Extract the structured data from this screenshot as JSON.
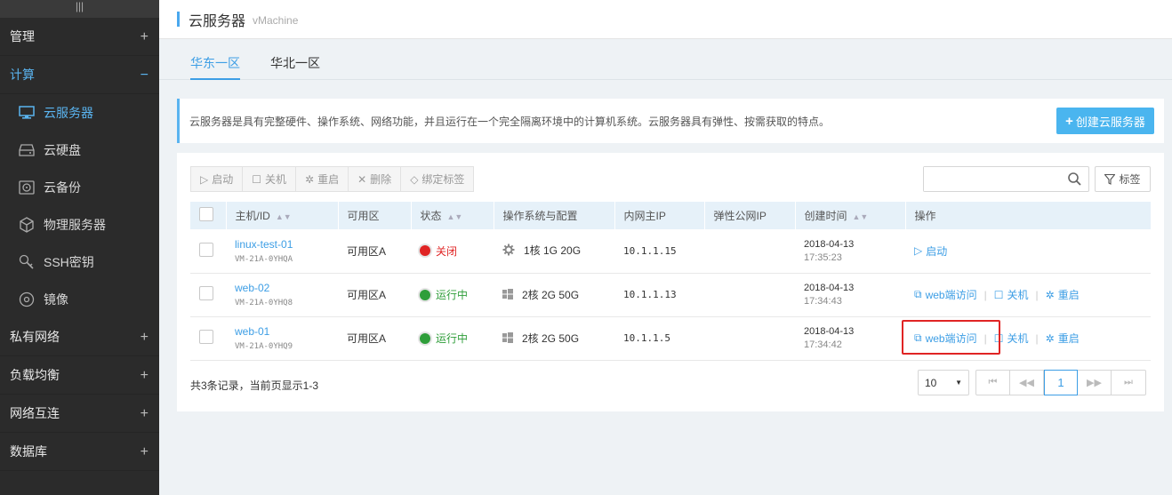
{
  "sidebar": {
    "groups": [
      {
        "label": "管理",
        "sign": "+"
      },
      {
        "label": "计算",
        "sign": "−"
      },
      {
        "label": "私有网络",
        "sign": "+"
      },
      {
        "label": "负载均衡",
        "sign": "+"
      },
      {
        "label": "网络互连",
        "sign": "+"
      },
      {
        "label": "数据库",
        "sign": "+"
      }
    ],
    "items": [
      {
        "label": "云服务器",
        "icon": "monitor-icon"
      },
      {
        "label": "云硬盘",
        "icon": "disk-icon"
      },
      {
        "label": "云备份",
        "icon": "backup-icon"
      },
      {
        "label": "物理服务器",
        "icon": "cube-icon"
      },
      {
        "label": "SSH密钥",
        "icon": "key-icon"
      },
      {
        "label": "镜像",
        "icon": "image-icon"
      }
    ],
    "accent": "#5ab4f0"
  },
  "header": {
    "title": "云服务器",
    "subtitle": "vMachine"
  },
  "tabs": [
    {
      "label": "华东一区"
    },
    {
      "label": "华北一区"
    }
  ],
  "info": {
    "text": "云服务器是具有完整硬件、操作系统、网络功能，并且运行在一个完全隔离环境中的计算机系统。云服务器具有弹性、按需获取的特点。",
    "create_label": "创建云服务器"
  },
  "toolbar": {
    "start": "启动",
    "stop": "关机",
    "restart": "重启",
    "delete": "删除",
    "bind_tag": "绑定标签",
    "search_placeholder": "",
    "tag_label": "标签"
  },
  "table": {
    "headers": [
      "主机/ID",
      "可用区",
      "状态",
      "操作系统与配置",
      "内网主IP",
      "弹性公网IP",
      "创建时间",
      "操作"
    ],
    "rows": [
      {
        "name": "linux-test-01",
        "id": "VM-21A-0YHQA",
        "zone": "可用区A",
        "status": "关闭",
        "status_color": "#e02424",
        "os": "linux",
        "config": "1核 1G 20G",
        "ip": "10.1.1.15",
        "eip": "",
        "date": "2018-04-13",
        "time": "17:35:23",
        "ops": [
          "启动"
        ]
      },
      {
        "name": "web-02",
        "id": "VM-21A-0YHQ8",
        "zone": "可用区A",
        "status": "运行中",
        "status_color": "#2f9e3a",
        "os": "windows",
        "config": "2核 2G 50G",
        "ip": "10.1.1.13",
        "eip": "",
        "date": "2018-04-13",
        "time": "17:34:43",
        "ops": [
          "web端访问",
          "关机",
          "重启"
        ]
      },
      {
        "name": "web-01",
        "id": "VM-21A-0YHQ9",
        "zone": "可用区A",
        "status": "运行中",
        "status_color": "#2f9e3a",
        "os": "windows",
        "config": "2核 2G 50G",
        "ip": "10.1.1.5",
        "eip": "",
        "date": "2018-04-13",
        "time": "17:34:42",
        "ops": [
          "web端访问",
          "关机",
          "重启"
        ]
      }
    ]
  },
  "footer": {
    "summary": "共3条记录，当前页显示1-3",
    "page_size": "10",
    "current_page": "1"
  }
}
